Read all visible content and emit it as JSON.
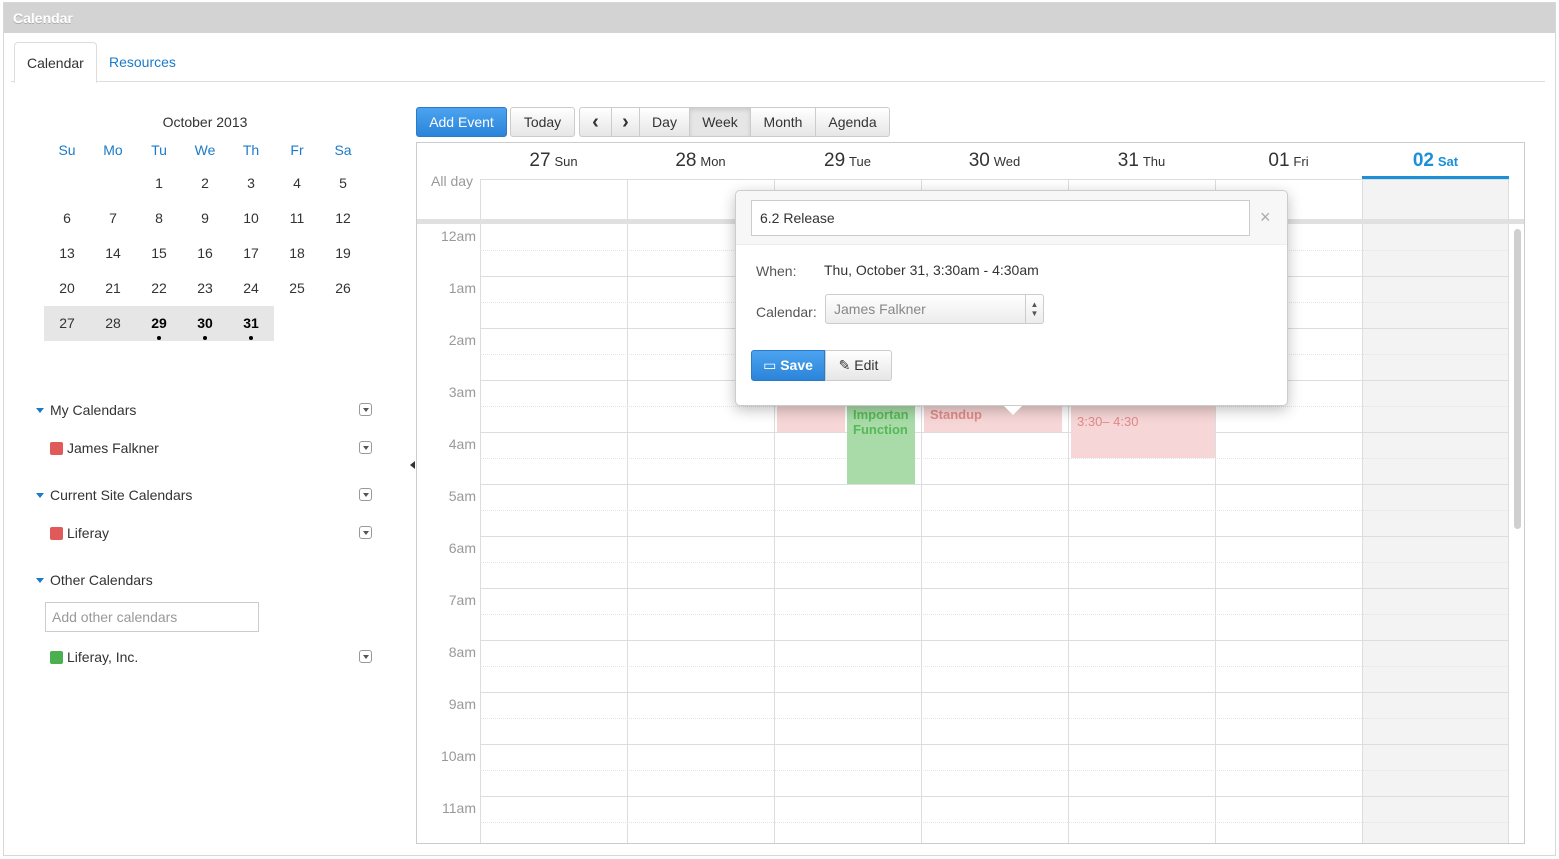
{
  "portlet": {
    "title": "Calendar"
  },
  "tabs": [
    {
      "label": "Calendar"
    },
    {
      "label": "Resources"
    }
  ],
  "mini_calendar": {
    "title": "October 2013",
    "weekdays": [
      "Su",
      "Mo",
      "Tu",
      "We",
      "Th",
      "Fr",
      "Sa"
    ],
    "weeks": [
      [
        "",
        "",
        "1",
        "2",
        "3",
        "4",
        "5"
      ],
      [
        "6",
        "7",
        "8",
        "9",
        "10",
        "11",
        "12"
      ],
      [
        "13",
        "14",
        "15",
        "16",
        "17",
        "18",
        "19"
      ],
      [
        "20",
        "21",
        "22",
        "23",
        "24",
        "25",
        "26"
      ],
      [
        "27",
        "28",
        "29",
        "30",
        "31",
        "",
        ""
      ]
    ]
  },
  "calendars": {
    "my": {
      "title": "My Calendars",
      "items": [
        {
          "label": "James Falkner",
          "color": "#e05a5a"
        }
      ]
    },
    "site": {
      "title": "Current Site Calendars",
      "items": [
        {
          "label": "Liferay",
          "color": "#e05a5a"
        }
      ]
    },
    "other": {
      "title": "Other Calendars",
      "placeholder": "Add other calendars",
      "items": [
        {
          "label": "Liferay, Inc.",
          "color": "#4caf50"
        }
      ]
    }
  },
  "toolbar": {
    "add_event": "Add Event",
    "today": "Today",
    "prev": "‹",
    "next": "›",
    "views": [
      "Day",
      "Week",
      "Month",
      "Agenda"
    ],
    "active_view": "Week"
  },
  "week": {
    "all_day": "All day",
    "days": [
      {
        "num": "27",
        "name": "Sun"
      },
      {
        "num": "28",
        "name": "Mon"
      },
      {
        "num": "29",
        "name": "Tue"
      },
      {
        "num": "30",
        "name": "Wed"
      },
      {
        "num": "31",
        "name": "Thu"
      },
      {
        "num": "01",
        "name": "Fri"
      },
      {
        "num": "02",
        "name": "Sat"
      }
    ],
    "hours": [
      "12am",
      "1am",
      "2am",
      "3am",
      "4am",
      "5am",
      "6am",
      "7am",
      "8am",
      "9am",
      "10am",
      "11am"
    ],
    "events": {
      "tue_important": "Importan Function",
      "wed_standup": "Standup",
      "thu_time": "3:30– 4:30"
    }
  },
  "popover": {
    "title": "6.2 Release",
    "close": "×",
    "when_label": "When:",
    "when_value": "Thu, October 31, 3:30am - 4:30am",
    "calendar_label": "Calendar:",
    "calendar_value": "James Falkner",
    "save": "Save",
    "edit": "Edit"
  },
  "colors": {
    "accent": "#1b8fd8",
    "primary_button": "#2b84d8",
    "event_red": "#f6d6d6",
    "event_green": "#a8dba8"
  }
}
